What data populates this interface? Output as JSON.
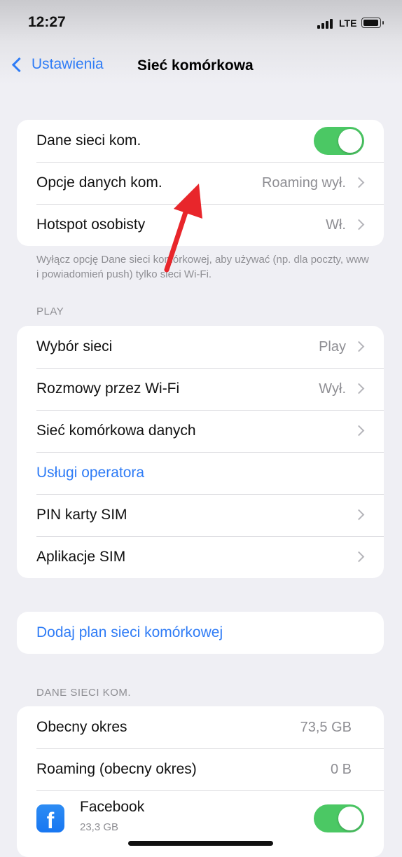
{
  "status": {
    "time": "12:27",
    "network": "LTE"
  },
  "nav": {
    "back_label": "Ustawienia",
    "title": "Sieć komórkowa"
  },
  "group1": {
    "rows": [
      {
        "label": "Dane sieci kom.",
        "toggle_on": true
      },
      {
        "label": "Opcje danych kom.",
        "value": "Roaming wył."
      },
      {
        "label": "Hotspot osobisty",
        "value": "Wł."
      }
    ],
    "footer": "Wyłącz opcję Dane sieci komórkowej, aby używać (np. dla poczty, www i powiadomień push) tylko sieci Wi-Fi."
  },
  "group2": {
    "header": "PLAY",
    "rows": [
      {
        "label": "Wybór sieci",
        "value": "Play"
      },
      {
        "label": "Rozmowy przez Wi-Fi",
        "value": "Wył."
      },
      {
        "label": "Sieć komórkowa danych"
      },
      {
        "label": "Usługi operatora"
      },
      {
        "label": "PIN karty SIM"
      },
      {
        "label": "Aplikacje SIM"
      }
    ]
  },
  "group3": {
    "label": "Dodaj plan sieci komórkowej"
  },
  "group4": {
    "header": "DANE SIECI KOM.",
    "rows": [
      {
        "label": "Obecny okres",
        "value": "73,5 GB"
      },
      {
        "label": "Roaming (obecny okres)",
        "value": "0 B"
      }
    ],
    "app": {
      "name": "Facebook",
      "size": "23,3 GB",
      "icon": "facebook-icon",
      "toggle_on": true
    }
  },
  "colors": {
    "accent": "#2f7cf6",
    "toggle_on": "#4bc864",
    "annotation_arrow": "#e8262b"
  }
}
